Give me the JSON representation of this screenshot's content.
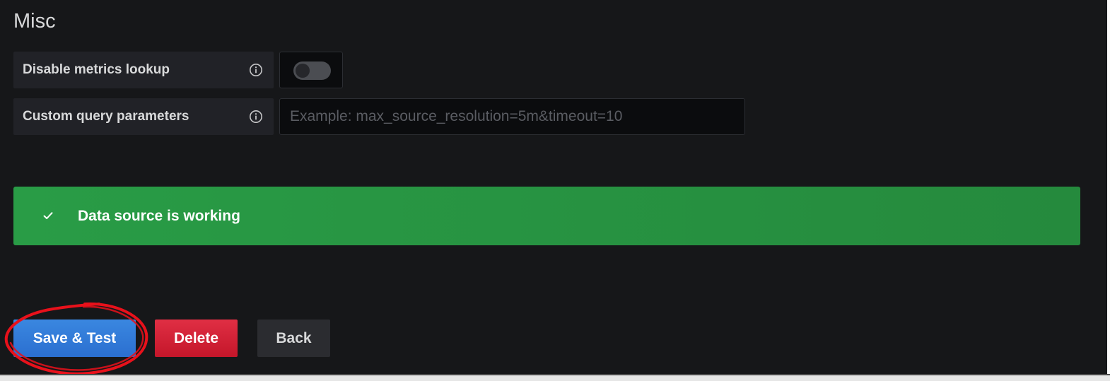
{
  "section": {
    "title": "Misc"
  },
  "fields": {
    "disable_metrics_lookup": {
      "label": "Disable metrics lookup",
      "value": false
    },
    "custom_query_parameters": {
      "label": "Custom query parameters",
      "value": "",
      "placeholder": "Example: max_source_resolution=5m&timeout=10"
    }
  },
  "alert": {
    "status": "success",
    "message": "Data source is working"
  },
  "buttons": {
    "save_test": "Save & Test",
    "delete": "Delete",
    "back": "Back"
  },
  "colors": {
    "background": "#161719",
    "success": "#299c46",
    "primary": "#3274d9",
    "danger": "#d44a3a",
    "annotation": "#e8111b"
  }
}
